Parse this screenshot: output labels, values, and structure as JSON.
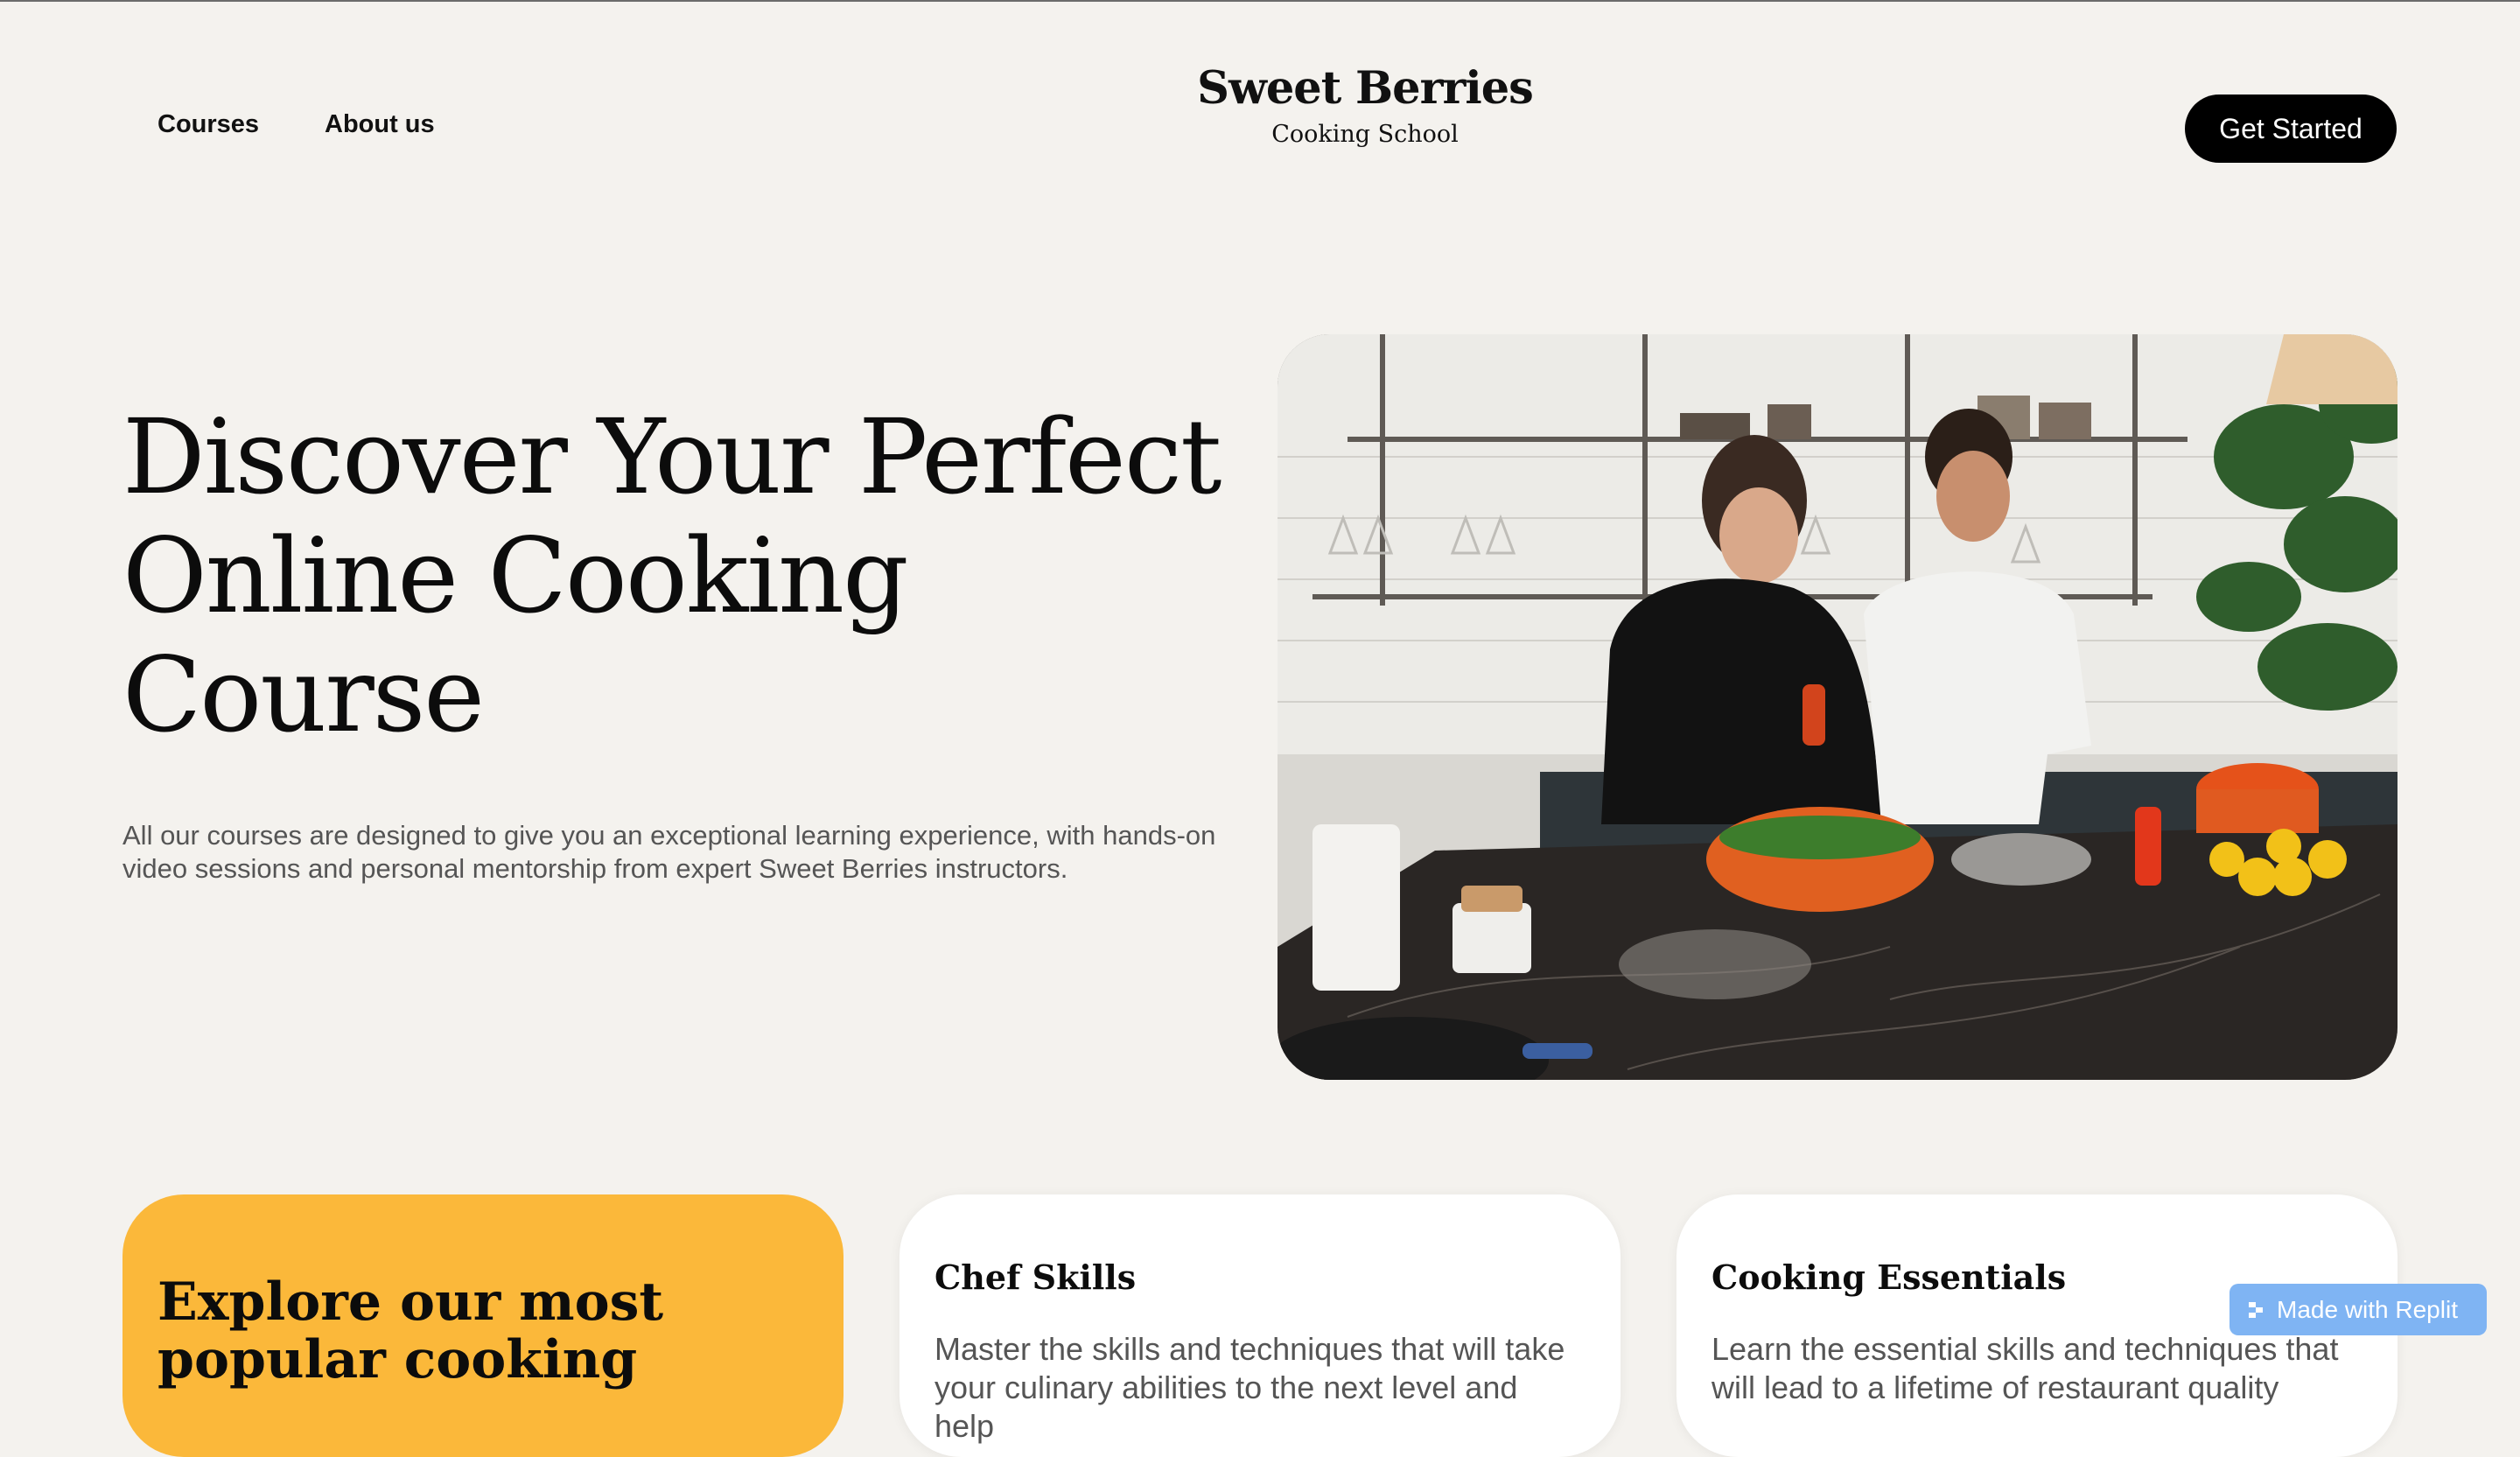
{
  "header": {
    "nav": [
      "Courses",
      "About us"
    ],
    "brand_name": "Sweet Berries",
    "brand_sub": "Cooking School",
    "cta_label": "Get Started"
  },
  "hero": {
    "title": "Discover Your Perfect Online Cooking Course",
    "description": "All our courses are designed to give you an exceptional learning experience, with hands-on video sessions and personal mentorship from expert Sweet Berries instructors.",
    "image_alt": "Two people cooking together in a kitchen"
  },
  "cards": [
    {
      "heading": "Explore our most popular cooking"
    },
    {
      "title": "Chef Skills",
      "description": "Master the skills and techniques that will take your culinary abilities to the next level and help"
    },
    {
      "title": "Cooking Essentials",
      "description": "Learn the essential skills and techniques that will lead to a lifetime of restaurant quality"
    }
  ],
  "badge": {
    "label": "Made with Replit"
  },
  "colors": {
    "background": "#f4f2ee",
    "accent_yellow": "#fbb83a",
    "cta": "#000000",
    "badge": "#7fb4f3"
  }
}
